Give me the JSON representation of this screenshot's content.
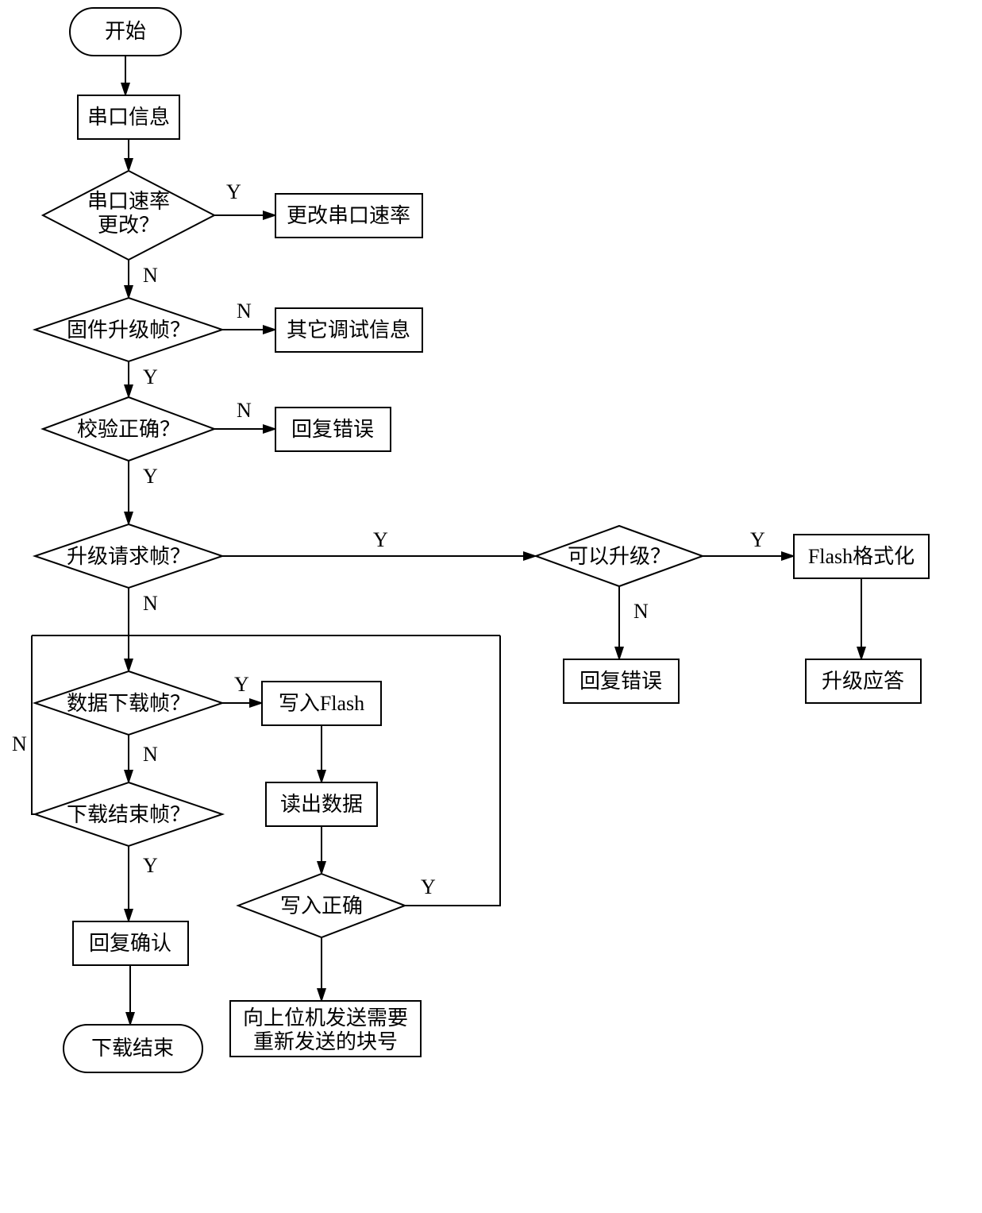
{
  "nodes": {
    "start": "开始",
    "serial_info": "串口信息",
    "rate_change_q": {
      "l1": "串口速率",
      "l2": "更改？"
    },
    "change_rate": "更改串口速率",
    "fw_frame_q": "固件升级帧？",
    "other_debug": "其它调试信息",
    "crc_ok_q": "校验正确？",
    "reply_error1": "回复错误",
    "upgrade_req_q": "升级请求帧？",
    "can_upgrade_q": "可以升级？",
    "flash_fmt": "Flash格式化",
    "reply_error2": "回复错误",
    "upgrade_ack": "升级应答",
    "data_dl_q": "数据下载帧？",
    "write_flash": "写入Flash",
    "read_data": "读出数据",
    "write_ok_q": "写入正确",
    "resend": {
      "l1": "向上位机发送需要",
      "l2": "重新发送的块号"
    },
    "dl_end_q": "下载结束帧？",
    "reply_confirm": "回复确认",
    "end": "下载结束"
  },
  "labels": {
    "Y": "Y",
    "N": "N"
  }
}
